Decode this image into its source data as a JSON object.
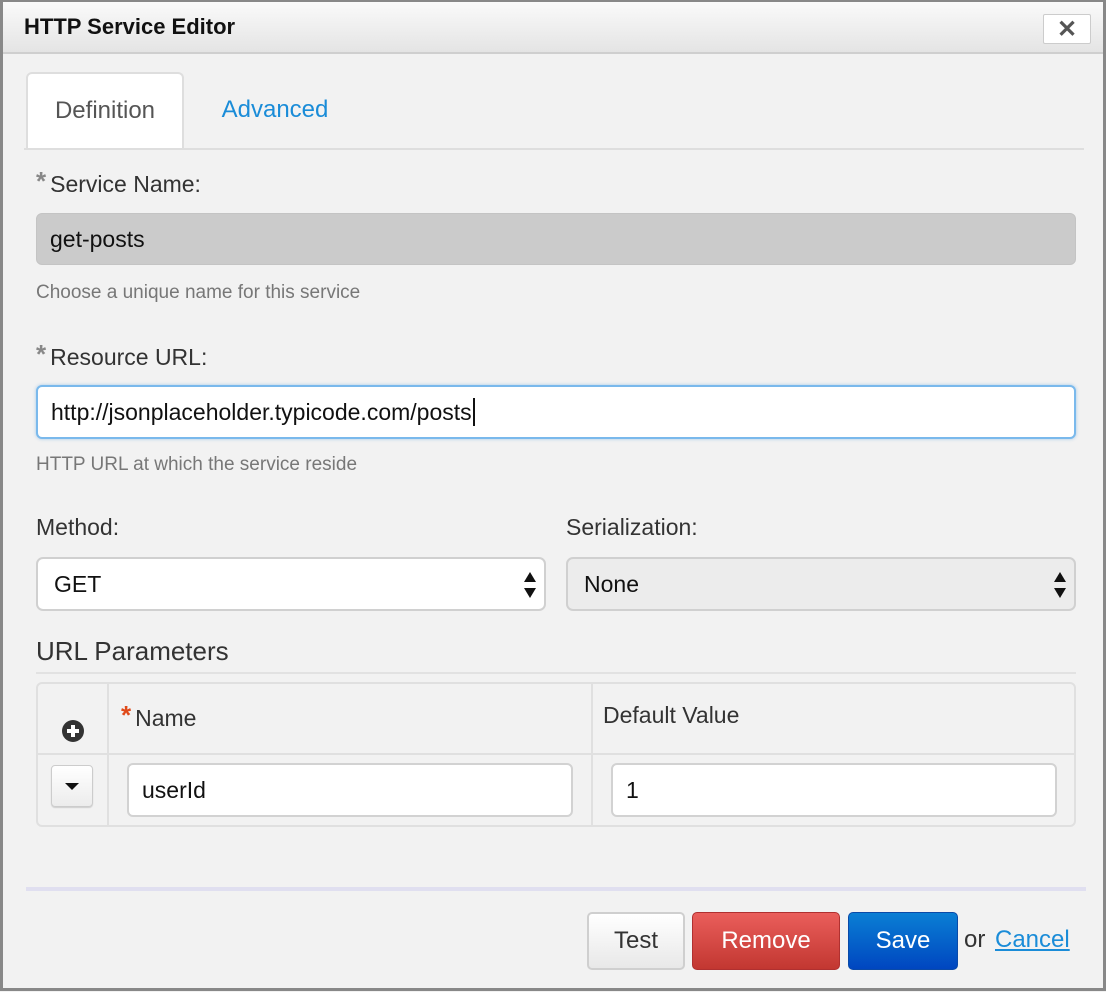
{
  "dialog": {
    "title": "HTTP Service Editor",
    "close_icon": "close-icon",
    "close_glyph": "✕"
  },
  "tabs": [
    {
      "label": "Definition",
      "active": true
    },
    {
      "label": "Advanced",
      "active": false
    }
  ],
  "service_name": {
    "required_marker": "*",
    "label": "Service Name:",
    "value": "get-posts",
    "disabled": true,
    "help": "Choose a unique name for this service"
  },
  "resource_url": {
    "required_marker": "*",
    "label": "Resource URL:",
    "value": "http://jsonplaceholder.typicode.com/posts",
    "focused": true,
    "help": "HTTP URL at which the service reside"
  },
  "method": {
    "label": "Method:",
    "selected": "GET"
  },
  "serialization": {
    "label": "Serialization:",
    "selected": "None"
  },
  "url_parameters": {
    "title": "URL Parameters",
    "add_icon": "plus-circle-icon",
    "columns": [
      {
        "required_marker": "*",
        "label": "Name"
      },
      {
        "label": "Default Value"
      }
    ],
    "rows": [
      {
        "menu_icon": "caret-down-icon",
        "name": "userId",
        "default_value": "1"
      }
    ]
  },
  "footer": {
    "test_label": "Test",
    "remove_label": "Remove",
    "save_label": "Save",
    "or_text": "or",
    "cancel_label": "Cancel"
  },
  "colors": {
    "link": "#1a8cd8",
    "remove": "#d9483f",
    "save": "#0a66cc",
    "required_red": "#e04a1a",
    "focus_border": "#7ab9ec"
  }
}
